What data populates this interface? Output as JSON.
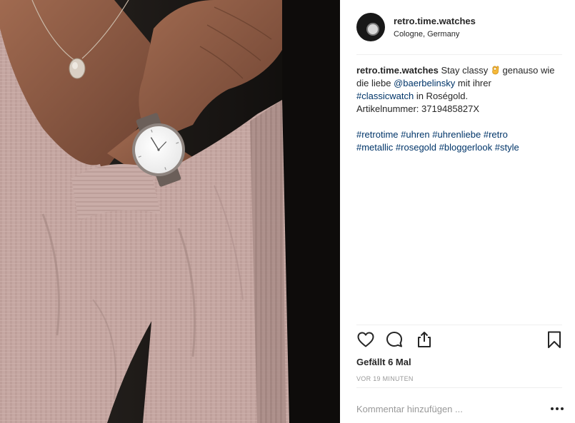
{
  "post": {
    "photo_alt": "",
    "colors": {
      "sweater": "#c7a9a4",
      "skin": "#8c5b45",
      "background": "#141210",
      "link": "#003569",
      "muted": "#999999"
    }
  },
  "header": {
    "username": "retro.time.watches",
    "location": "Cologne, Germany"
  },
  "caption": {
    "username": "retro.time.watches",
    "line1_text": "Stay classy",
    "emoji_icon": "ok-hand-emoji",
    "line1_after": "genauso wie",
    "line2_before": "die liebe",
    "mention": "@baerbelinsky",
    "line2_after": "mit ihrer",
    "hashtag_classic": "#classicwatch",
    "line3_after": "in Roségold.",
    "article_number": "Artikelnummer: 3719485827X",
    "hashtags_row1": [
      "#retrotime",
      "#uhren",
      "#uhrenliebe",
      "#retro"
    ],
    "hashtags_row2": [
      "#metallic",
      "#rosegold",
      "#bloggerlook",
      "#style"
    ]
  },
  "actions": {
    "like_icon": "heart-icon",
    "comment_icon": "comment-icon",
    "share_icon": "share-icon",
    "save_icon": "bookmark-icon"
  },
  "likes": "Gefällt 6 Mal",
  "timestamp": "VOR 19 MINUTEN",
  "comment": {
    "placeholder": "Kommentar hinzufügen ...",
    "more_icon": "more-options-icon"
  }
}
